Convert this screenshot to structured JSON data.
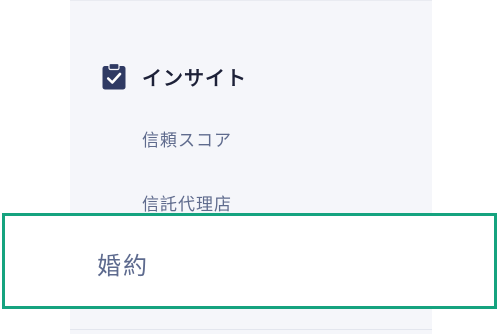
{
  "sidebar": {
    "section": {
      "icon": "clipboard-check-icon",
      "title": "インサイト"
    },
    "items": [
      {
        "label": "信頼スコア"
      },
      {
        "label": "信託代理店"
      }
    ]
  },
  "highlight": {
    "label": "婚約",
    "border_color": "#15a37f"
  },
  "colors": {
    "sidebar_bg": "#f5f6fa",
    "title_text": "#1d2138",
    "item_text": "#5f6b8d",
    "icon_fill": "#2f3a63"
  }
}
